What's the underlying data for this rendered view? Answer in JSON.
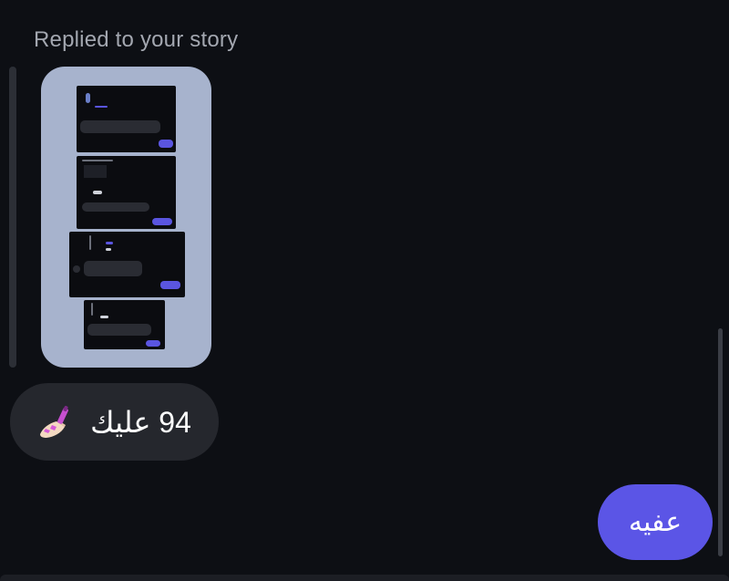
{
  "reply_label": "Replied to your story",
  "incoming_message": {
    "text": "94 عليك",
    "emoji_icon": "nail-polish-icon"
  },
  "outgoing_message": {
    "text": "عفيه"
  },
  "colors": {
    "background": "#0d0f14",
    "incoming_bubble": "#25272d",
    "outgoing_bubble": "#5b55e6",
    "story_card": "#a7b3cd",
    "label_text": "#a3a7b0"
  }
}
